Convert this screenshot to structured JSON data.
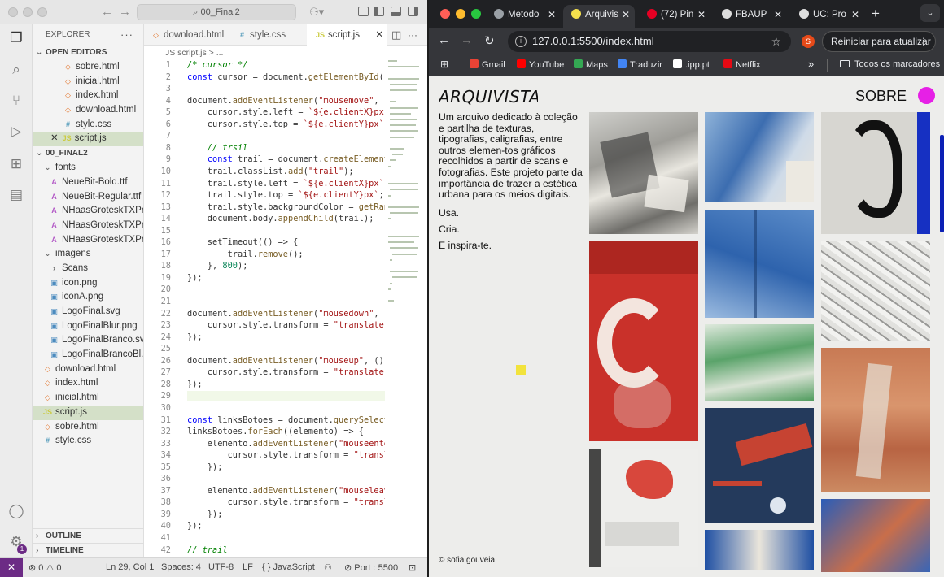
{
  "vscode": {
    "search": "⌕ 00_Final2",
    "explorer_title": "EXPLORER",
    "open_editors_label": "OPEN EDITORS",
    "open_editors": [
      {
        "name": "sobre.html",
        "type": "h"
      },
      {
        "name": "inicial.html",
        "type": "h"
      },
      {
        "name": "index.html",
        "type": "h"
      },
      {
        "name": "download.html",
        "type": "h"
      },
      {
        "name": "style.css",
        "type": "c"
      },
      {
        "name": "script.js",
        "type": "j",
        "close": "✕"
      }
    ],
    "folder_label": "00_FINAL2",
    "tree": [
      {
        "name": "fonts",
        "type": "d",
        "depth": 1
      },
      {
        "name": "NeueBit-Bold.ttf",
        "type": "a",
        "depth": 2
      },
      {
        "name": "NeueBit-Regular.ttf",
        "type": "a",
        "depth": 2
      },
      {
        "name": "NHaasGroteskTXPr...",
        "type": "a",
        "depth": 2
      },
      {
        "name": "NHaasGroteskTXPr...",
        "type": "a",
        "depth": 2
      },
      {
        "name": "NHaasGroteskTXPr...",
        "type": "a",
        "depth": 2
      },
      {
        "name": "imagens",
        "type": "d",
        "depth": 1
      },
      {
        "name": "Scans",
        "type": "dc",
        "depth": 2
      },
      {
        "name": "icon.png",
        "type": "i",
        "depth": 2
      },
      {
        "name": "iconA.png",
        "type": "i",
        "depth": 2
      },
      {
        "name": "LogoFinal.svg",
        "type": "i",
        "depth": 2
      },
      {
        "name": "LogoFinalBlur.png",
        "type": "i",
        "depth": 2
      },
      {
        "name": "LogoFinalBranco.svg",
        "type": "i",
        "depth": 2
      },
      {
        "name": "LogoFinalBrancoBl...",
        "type": "i",
        "depth": 2
      },
      {
        "name": "download.html",
        "type": "h",
        "depth": 1
      },
      {
        "name": "index.html",
        "type": "h",
        "depth": 1
      },
      {
        "name": "inicial.html",
        "type": "h",
        "depth": 1
      },
      {
        "name": "script.js",
        "type": "j",
        "depth": 1,
        "selected": true
      },
      {
        "name": "sobre.html",
        "type": "h",
        "depth": 1
      },
      {
        "name": "style.css",
        "type": "c",
        "depth": 1
      }
    ],
    "outline_label": "OUTLINE",
    "timeline_label": "TIMELINE",
    "tabs": [
      "download.html",
      "style.css",
      "script.js"
    ],
    "breadcrumb": "JS script.js > ...",
    "code_lines": [
      "/* cursor */",
      "const cursor = document.getElementById(\"cu",
      "",
      "document.addEventListener(\"mousemove\", (e)",
      "    cursor.style.left = `${e.clientX}px`;",
      "    cursor.style.top = `${e.clientY}px`;",
      "",
      "    // trsil",
      "    const trail = document.createElement(\"",
      "    trail.classList.add(\"trail\");",
      "    trail.style.left = `${e.clientX}px`;",
      "    trail.style.top = `${e.clientY}px`;",
      "    trail.style.backgroundColor = getRando",
      "    document.body.appendChild(trail);",
      "",
      "    setTimeout(() => {",
      "        trail.remove();",
      "    }, 800);",
      "});",
      "",
      "",
      "document.addEventListener(\"mousedown\", ()",
      "    cursor.style.transform = \"translate(-5",
      "});",
      "",
      "document.addEventListener(\"mouseup\", () =>",
      "    cursor.style.transform = \"translate(-5",
      "});",
      "",
      "",
      "const linksBotoes = document.querySelector",
      "linksBotoes.forEach((elemento) => {",
      "    elemento.addEventListener(\"mouseenter\"",
      "        cursor.style.transform = \"translat",
      "    });",
      "",
      "    elemento.addEventListener(\"mouseleave\"",
      "        cursor.style.transform = \"translat",
      "    });",
      "});",
      "",
      "// trail"
    ],
    "status": {
      "remote": "✕",
      "problems": "⊗ 0 ⚠ 0",
      "position": "Ln 29, Col 1",
      "spaces": "Spaces: 4",
      "encoding": "UTF-8",
      "eol": "LF",
      "language": "{ } JavaScript",
      "port": "⊘ Port : 5500"
    }
  },
  "chrome": {
    "tabs": [
      {
        "title": "Metodo",
        "color": "#9aa0a6"
      },
      {
        "title": "Arquivis",
        "color": "#f4e04d",
        "active": true
      },
      {
        "title": "(72) Pin",
        "color": "#e60023"
      },
      {
        "title": "FBAUP",
        "color": "#dddddd"
      },
      {
        "title": "UC: Pro",
        "color": "#dddddd"
      }
    ],
    "url": "127.0.0.1:5500/index.html",
    "profile_initial": "S",
    "relaunch_label": "Reiniciar para atualizar",
    "bookmarks": [
      {
        "label": "Gmail",
        "color": "#ea4335"
      },
      {
        "label": "YouTube",
        "color": "#ff0000"
      },
      {
        "label": "Maps",
        "color": "#34a853"
      },
      {
        "label": "Traduzir",
        "color": "#4285f4"
      },
      {
        "label": ".ipp.pt",
        "color": "#ffffff"
      },
      {
        "label": "Netflix",
        "color": "#e50914"
      }
    ],
    "bookmarks_more": "»",
    "all_bookmarks": "Todos os marcadores"
  },
  "site": {
    "logo": "ARQUIVISTA",
    "nav_sobre": "SOBRE",
    "about": "Um arquivo dedicado à coleção e partilha de texturas, tipografias, caligrafias, entre outros elemen-tos gráficos recolhidos a partir de scans e fotografias. Este projeto parte da importância de trazer a estética urbana para os meios digitais.",
    "punch": [
      "Usa.",
      "Cria.",
      "E inspira-te."
    ],
    "credit": "© sofia gouveia",
    "accent": "#e620e6"
  }
}
